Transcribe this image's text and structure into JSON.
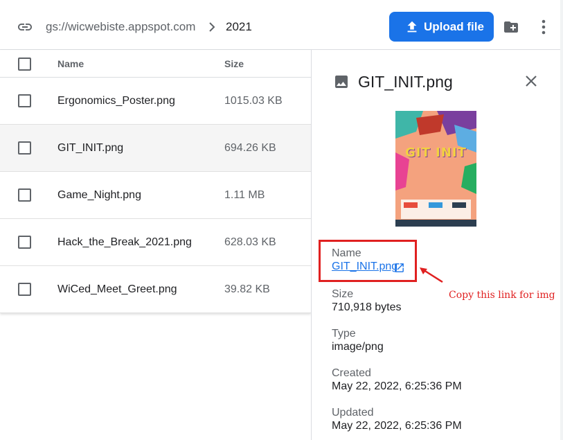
{
  "toolbar": {
    "bucket_path": "gs://wicwebiste.appspot.com",
    "current_folder": "2021",
    "upload_label": "Upload file"
  },
  "table": {
    "columns": {
      "name": "Name",
      "size": "Size"
    },
    "rows": [
      {
        "name": "Ergonomics_Poster.png",
        "size": "1015.03 KB"
      },
      {
        "name": "GIT_INIT.png",
        "size": "694.26 KB"
      },
      {
        "name": "Game_Night.png",
        "size": "1.11 MB"
      },
      {
        "name": "Hack_the_Break_2021.png",
        "size": "628.03 KB"
      },
      {
        "name": "WiCed_Meet_Greet.png",
        "size": "39.82 KB"
      }
    ]
  },
  "details": {
    "title": "GIT_INIT.png",
    "preview_text": "GIT INIT",
    "name_label": "Name",
    "name_value": "GIT_INIT.png",
    "size_label": "Size",
    "size_value": "710,918 bytes",
    "type_label": "Type",
    "type_value": "image/png",
    "created_label": "Created",
    "created_value": "May 22, 2022, 6:25:36 PM",
    "updated_label": "Updated",
    "updated_value": "May 22, 2022, 6:25:36 PM"
  },
  "annotation": {
    "text": "Copy this link for img",
    "color": "#e02020"
  },
  "colors": {
    "accent": "#1a73e8",
    "poster_bg": "#f4a27e",
    "poster_title": "#f2d23f"
  }
}
